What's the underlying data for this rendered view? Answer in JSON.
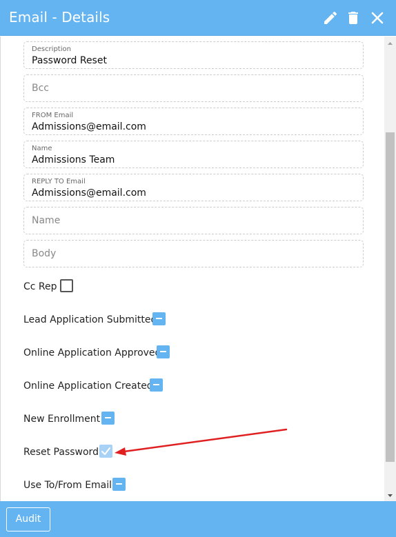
{
  "header": {
    "title": "Email - Details",
    "icons": {
      "edit": "pencil-icon",
      "delete": "trash-icon",
      "close": "close-icon"
    },
    "color": "#64b4f2"
  },
  "fields": [
    {
      "label": "Description",
      "value": "Password Reset",
      "placeholder": ""
    },
    {
      "label": "",
      "value": "",
      "placeholder": "Bcc"
    },
    {
      "label": "FROM Email",
      "value": "Admissions@email.com",
      "placeholder": ""
    },
    {
      "label": "Name",
      "value": "Admissions Team",
      "placeholder": ""
    },
    {
      "label": "REPLY TO Email",
      "value": "Admissions@email.com",
      "placeholder": ""
    },
    {
      "label": "",
      "value": "",
      "placeholder": "Name"
    },
    {
      "label": "",
      "value": "",
      "placeholder": "Body"
    }
  ],
  "checks": [
    {
      "label": "Cc Rep",
      "state": "unchecked"
    },
    {
      "label": "Lead Application Submitted",
      "state": "indeterminate"
    },
    {
      "label": "Online Application Approved",
      "state": "indeterminate"
    },
    {
      "label": "Online Application Created",
      "state": "indeterminate"
    },
    {
      "label": "New Enrollment",
      "state": "indeterminate"
    },
    {
      "label": "Reset Password",
      "state": "checked"
    },
    {
      "label": "Use To/From Email",
      "state": "indeterminate"
    }
  ],
  "annotation": {
    "color": "#e02020",
    "target": "Reset Password"
  },
  "footer": {
    "audit_label": "Audit"
  }
}
